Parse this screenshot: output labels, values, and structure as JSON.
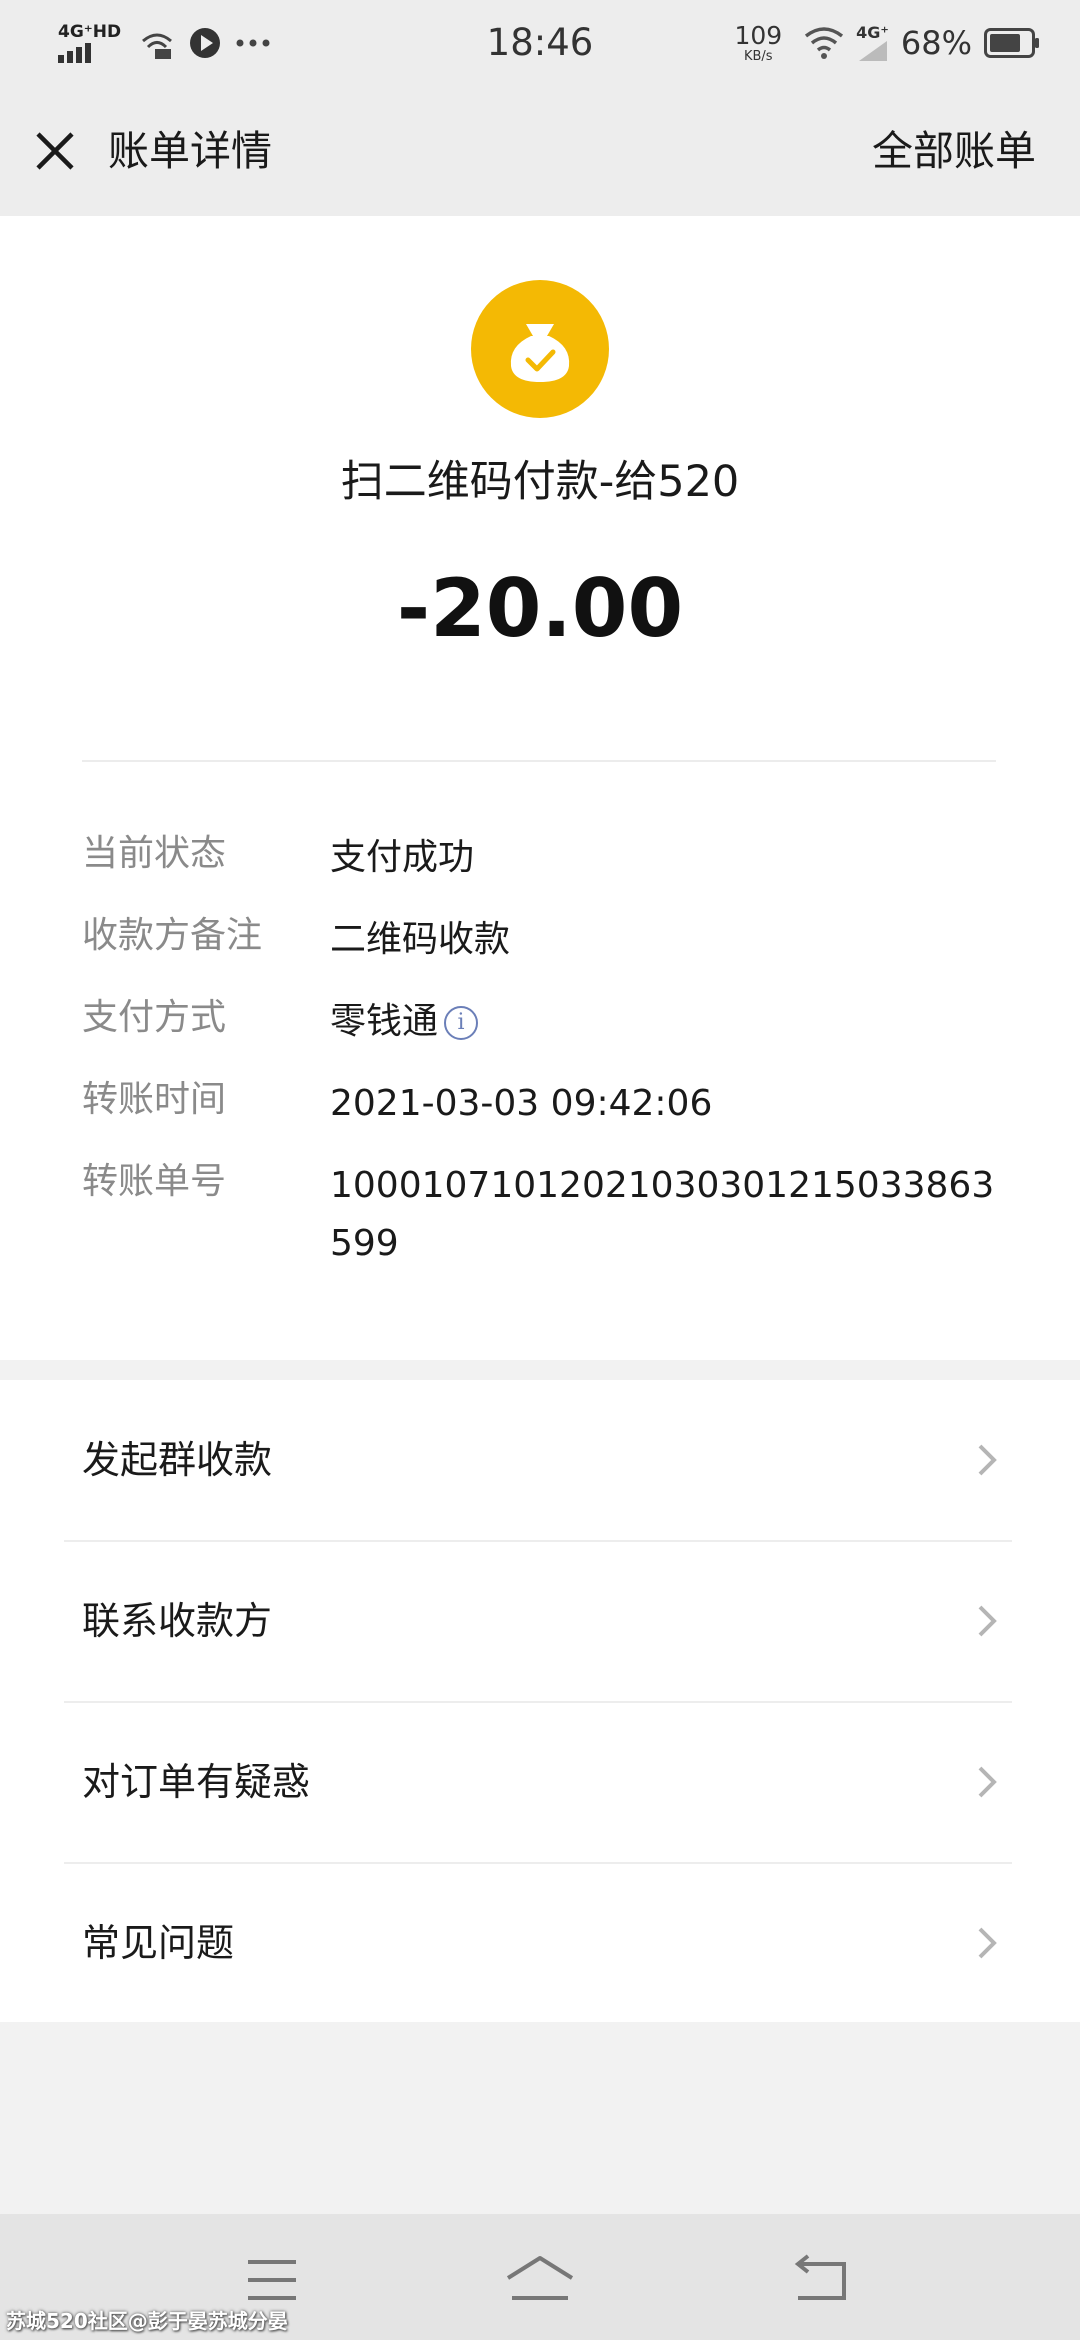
{
  "status_bar": {
    "network_label": "4G⁺HD",
    "time": "18:46",
    "speed_value": "109",
    "speed_unit": "KB/s",
    "cell_label": "4G⁺",
    "battery": "68%"
  },
  "header": {
    "title": "账单详情",
    "all_bills": "全部账单"
  },
  "detail": {
    "merchant": "扫二维码付款-给520",
    "amount": "-20.00",
    "rows": [
      {
        "label": "当前状态",
        "value": "支付成功"
      },
      {
        "label": "收款方备注",
        "value": "二维码收款"
      },
      {
        "label": "支付方式",
        "value": "零钱通"
      },
      {
        "label": "转账时间",
        "value": "2021-03-03 09:42:06"
      },
      {
        "label": "转账单号",
        "value": "10001071012021030301215033863599"
      }
    ],
    "info_icon_glyph": "i"
  },
  "actions": [
    {
      "label": "发起群收款"
    },
    {
      "label": "联系收款方"
    },
    {
      "label": "对订单有疑惑"
    },
    {
      "label": "常见问题"
    }
  ],
  "watermark": "苏城520社区@彭于晏苏城分晏",
  "colors": {
    "coin": "#f4b904",
    "background": "#f2f2f2",
    "info_icon": "#6b7fb8"
  }
}
